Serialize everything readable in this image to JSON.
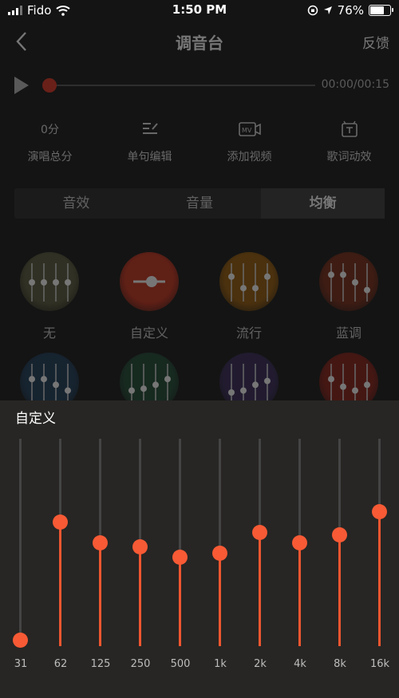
{
  "status_bar": {
    "carrier": "Fido",
    "time": "1:50 PM",
    "battery": "76%",
    "battery_level": 0.76
  },
  "nav": {
    "title": "调音台",
    "right_label": "反馈",
    "back_icon": "chevron-left-icon"
  },
  "player": {
    "time": "00:00/00:15",
    "progress": 0
  },
  "tools": [
    {
      "label": "演唱总分",
      "value": "0分"
    },
    {
      "label": "单句编辑",
      "icon": "edit-lines-icon"
    },
    {
      "label": "添加视频",
      "icon": "mv-video-icon"
    },
    {
      "label": "歌词动效",
      "icon": "lyrics-effect-icon"
    }
  ],
  "tabs": [
    {
      "label": "音效"
    },
    {
      "label": "音量"
    },
    {
      "label": "均衡",
      "active": true
    }
  ],
  "presets": [
    {
      "label": "无",
      "color": "#5a5a3c"
    },
    {
      "label": "自定义",
      "color": "#c8321c"
    },
    {
      "label": "流行",
      "color": "#9a5c08"
    },
    {
      "label": "蓝调",
      "color": "#7a2a14"
    },
    {
      "label": "",
      "color": "#1c3c5a"
    },
    {
      "label": "",
      "color": "#1e4a34"
    },
    {
      "label": "",
      "color": "#38285a"
    },
    {
      "label": "",
      "color": "#8a1e14"
    }
  ],
  "equalizer": {
    "title": "自定义",
    "accent": "#f75a35",
    "bands": [
      {
        "freq": "31",
        "level": 0.03
      },
      {
        "freq": "62",
        "level": 0.6
      },
      {
        "freq": "125",
        "level": 0.5
      },
      {
        "freq": "250",
        "level": 0.48
      },
      {
        "freq": "500",
        "level": 0.43
      },
      {
        "freq": "1k",
        "level": 0.45
      },
      {
        "freq": "2k",
        "level": 0.55
      },
      {
        "freq": "4k",
        "level": 0.5
      },
      {
        "freq": "8k",
        "level": 0.54
      },
      {
        "freq": "16k",
        "level": 0.65
      }
    ]
  }
}
